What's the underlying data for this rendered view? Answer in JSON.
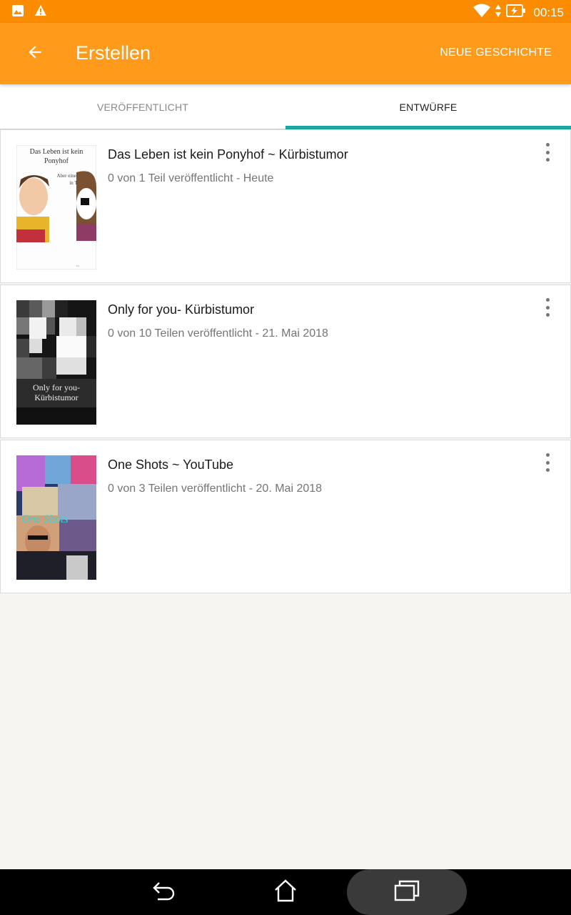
{
  "status_bar": {
    "time": "00:15",
    "left_icons": [
      "image-icon",
      "warning-icon"
    ],
    "right_icons": [
      "wifi-icon",
      "data-arrows-icon",
      "battery-charging-icon"
    ]
  },
  "app_bar": {
    "title": "Erstellen",
    "action_label": "NEUE GESCHICHTE",
    "background": "#ff9a1a"
  },
  "tabs": [
    {
      "label": "VERÖFFENTLICHT",
      "selected": false
    },
    {
      "label": "ENTWÜRFE",
      "selected": true
    }
  ],
  "accent_color": "#1aa5a0",
  "stories": [
    {
      "title": "Das Leben ist kein Ponyhof ~ Kürbistumor",
      "meta": "0 von 1 Teil veröffentlicht - Heute",
      "cover_text": [
        "Das Leben ist kein",
        "Ponyhof",
        "Aber eine Ranch",
        "in Texas"
      ]
    },
    {
      "title": "Only for you- Kürbistumor",
      "meta": "0 von 10 Teilen veröffentlicht - 21. Mai 2018",
      "cover_text": [
        "Only for you-",
        "Kürbistumor"
      ]
    },
    {
      "title": "One Shots ~ YouTube",
      "meta": "0 von 3 Teilen veröffentlicht - 20. Mai 2018",
      "cover_text": [
        "One Shots"
      ]
    }
  ],
  "nav_bar": {
    "buttons": [
      "back-icon",
      "home-icon",
      "recents-icon"
    ]
  }
}
